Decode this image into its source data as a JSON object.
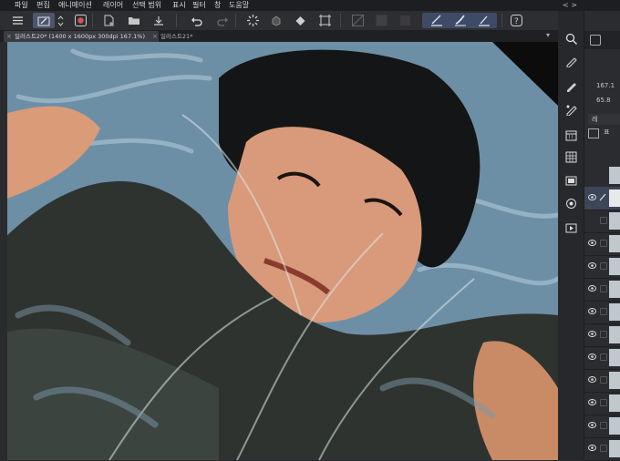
{
  "menu": {
    "items": [
      "파일",
      "편집",
      "애니메이션",
      "레이어",
      "선택 범위",
      "표시",
      "필터",
      "창",
      "도움말"
    ],
    "right_arrows": "< >"
  },
  "toolbar": {
    "buttons": [
      "menu-icon",
      "pen-icon",
      "spin-icon",
      "record-icon",
      "new-file-icon",
      "open-folder-icon",
      "save-icon",
      "undo-icon",
      "redo-icon",
      "loading-icon",
      "fill-icon",
      "transform-icon",
      "grid-icon",
      "selection-icon",
      "clear-icon",
      "brush-1-icon",
      "brush-2-icon",
      "brush-3-icon",
      "help-icon"
    ]
  },
  "tabs": [
    {
      "label": "일러스트20* (1400 x 1600px 300dpi 167.1%)",
      "active": true
    },
    {
      "label": "일러스트21*",
      "active": false
    }
  ],
  "sidebar": {
    "zoom": "167.1",
    "angle": "65.8",
    "label_a": "레",
    "label_b": "표"
  },
  "colors": {
    "sky": "#6d8fa5",
    "hair": "#141516",
    "skin": "#d89a7a",
    "coat": "#2e332f",
    "ui_bg": "#2a2b2e",
    "accent": "#4d556b"
  }
}
